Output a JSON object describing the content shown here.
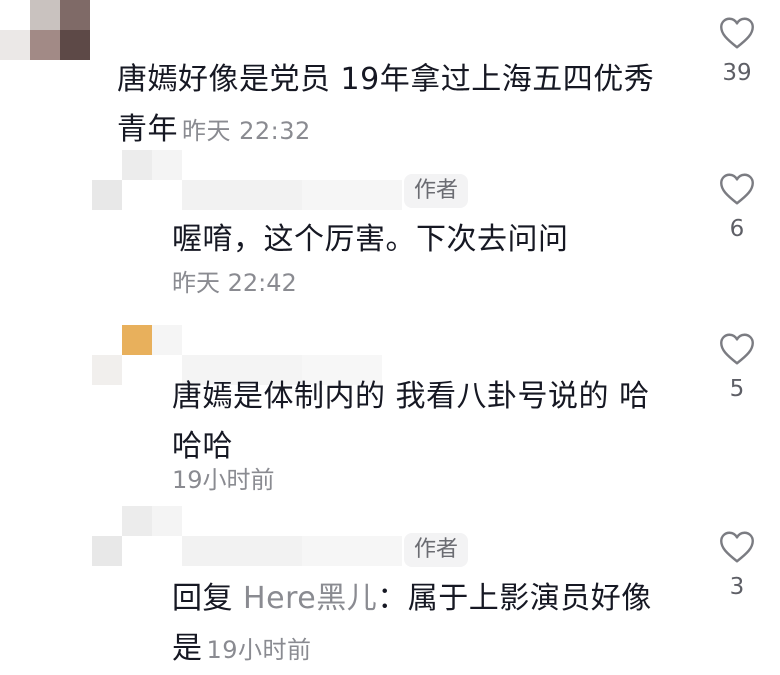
{
  "comments": [
    {
      "text_line1": "唐嫣好像是党员 19年拿过上海五四优秀",
      "text_line2": "青年",
      "time": "昨天 22:32",
      "likes": "39"
    },
    {
      "author_badge": "作者",
      "text": "喔唷，这个厉害。下次去问问",
      "time": "昨天 22:42",
      "likes": "6"
    },
    {
      "text_line1": "唐嫣是体制内的 我看八卦号说的 哈",
      "text_line2": "哈哈",
      "time": "19小时前",
      "likes": "5"
    },
    {
      "author_badge": "作者",
      "reply_prefix": "回复",
      "reply_target": "Here黑儿",
      "reply_sep": "：",
      "text_line1": "属于上影演员好像",
      "text_line2": "是",
      "time": "19小时前",
      "likes": "3"
    }
  ],
  "icons": {
    "like": "heart-outline-icon"
  },
  "colors": {
    "text": "#161823",
    "meta": "#8a8b91",
    "reply_target": "#8a8b91",
    "badge_bg": "#f3f3f4"
  }
}
